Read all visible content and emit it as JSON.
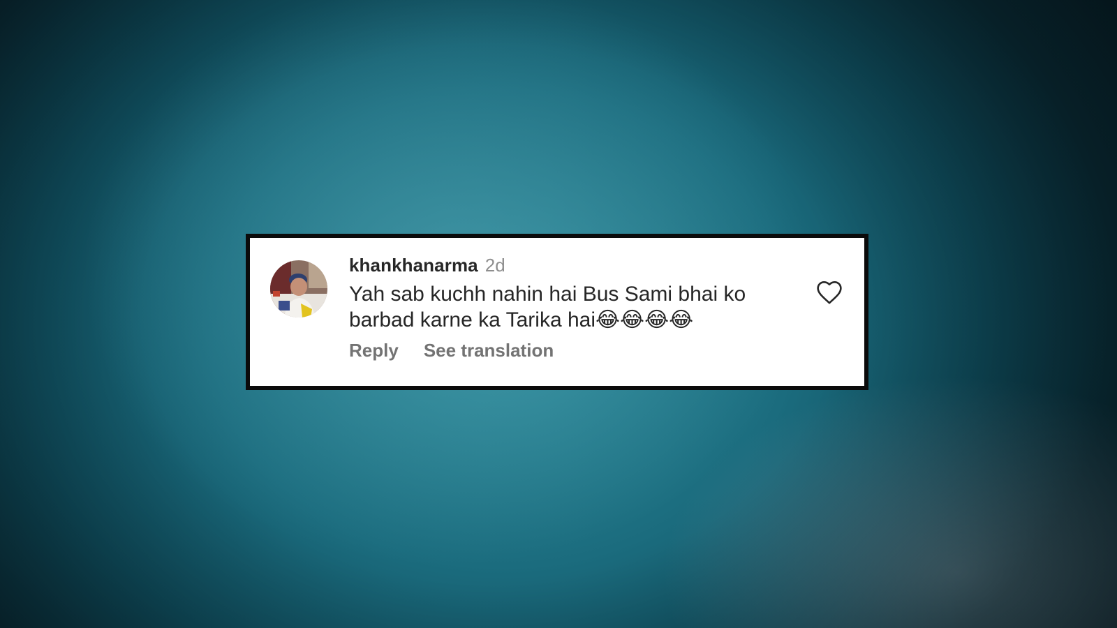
{
  "comment": {
    "username": "khankhanarma",
    "time_ago": "2d",
    "text": "Yah sab kuchh nahin hai Bus Sami bhai ko barbad karne ka Tarika hai😂😂😂😂",
    "actions": {
      "reply_label": "Reply",
      "translate_label": "See translation"
    },
    "icons": {
      "like": "heart-icon",
      "avatar": "user-avatar"
    }
  },
  "colors": {
    "username": "#262626",
    "secondary_text": "#8e8e8e",
    "action_text": "#737373",
    "card_border": "#0b0b0b",
    "background_teal": "#1b6c7e"
  }
}
